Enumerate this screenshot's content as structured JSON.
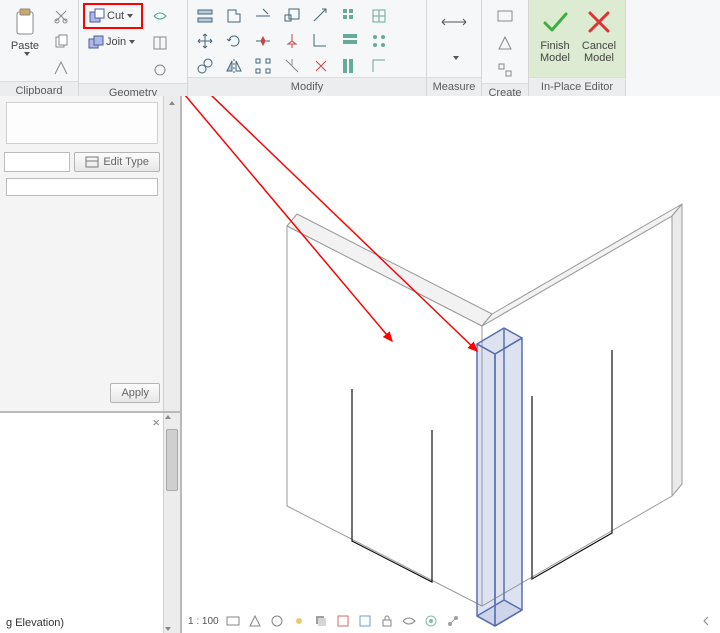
{
  "ribbon": {
    "clipboard": {
      "title": "Clipboard",
      "paste": "Paste"
    },
    "geometry": {
      "title": "Geometry",
      "cut": "Cut",
      "join": "Join"
    },
    "modify": {
      "title": "Modify"
    },
    "measure": {
      "title": "Measure"
    },
    "create": {
      "title": "Create"
    },
    "inplace": {
      "title": "In-Place Editor",
      "finish": "Finish\nModel",
      "cancel": "Cancel\nModel"
    }
  },
  "properties": {
    "edit_type": "Edit Type",
    "apply": "Apply",
    "tree_item": "g Elevation)"
  },
  "viewbar": {
    "scale": "1 : 100"
  }
}
